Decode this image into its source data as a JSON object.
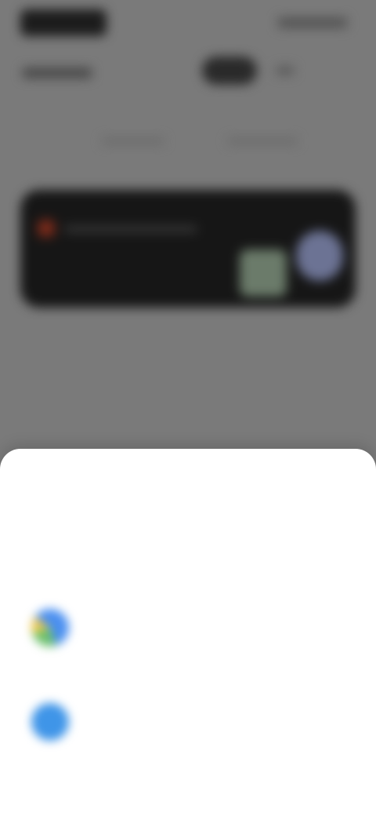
{
  "sheet": {
    "title": "",
    "subtitle": "",
    "options": [
      {
        "icon": "google-icon",
        "label": "",
        "description": ""
      },
      {
        "icon": "passkey-icon",
        "label": "",
        "description": ""
      }
    ]
  },
  "colors": {
    "overlay": "#7a7a7a",
    "sheet_background": "#ffffff",
    "promo_card": "#161616",
    "passkey_icon": "#3f95e8"
  }
}
